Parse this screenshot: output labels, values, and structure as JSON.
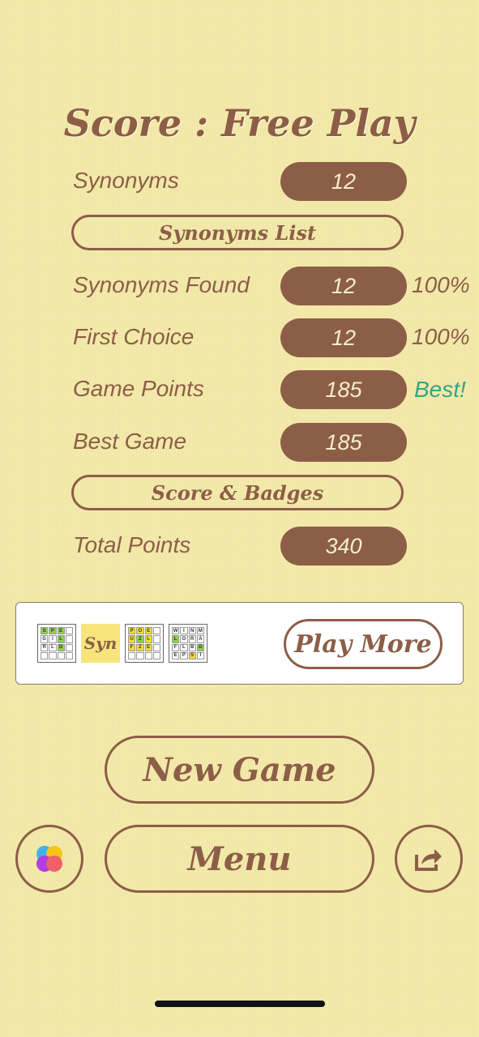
{
  "title": "Score : Free Play",
  "rows": {
    "synonyms": {
      "label": "Synonyms",
      "value": "12"
    },
    "synonyms_found": {
      "label": "Synonyms Found",
      "value": "12",
      "suffix": "100%"
    },
    "first_choice": {
      "label": "First Choice",
      "value": "12",
      "suffix": "100%"
    },
    "game_points": {
      "label": "Game Points",
      "value": "185",
      "suffix": "Best!"
    },
    "best_game": {
      "label": "Best Game",
      "value": "185"
    },
    "total_points": {
      "label": "Total Points",
      "value": "340"
    }
  },
  "buttons": {
    "synonyms_list": "Synonyms List",
    "score_badges": "Score & Badges",
    "play_more": "Play More",
    "new_game": "New Game",
    "menu": "Menu"
  },
  "ad": {
    "thumb1": [
      "S",
      "P",
      "E",
      "",
      "G",
      "I",
      "L",
      "",
      "R",
      "L",
      "D",
      "",
      "",
      "",
      "",
      ""
    ],
    "thumb_syn": "Syn",
    "thumb3": [
      "P",
      "O",
      "E",
      "",
      "U",
      "Z",
      "L",
      "",
      "F",
      "Z",
      "E",
      "",
      "",
      "",
      "",
      ""
    ],
    "thumb4": [
      "W",
      "I",
      "N",
      "M",
      "L",
      "O",
      "R",
      "A",
      "F",
      "L",
      "B",
      "D",
      "E",
      "P",
      "S",
      "I"
    ]
  },
  "colors": {
    "accent": "#8c5e47",
    "background": "#f3e9a8",
    "best": "#2fa68a"
  },
  "icons": {
    "left": "game-center-icon",
    "right": "share-icon"
  }
}
